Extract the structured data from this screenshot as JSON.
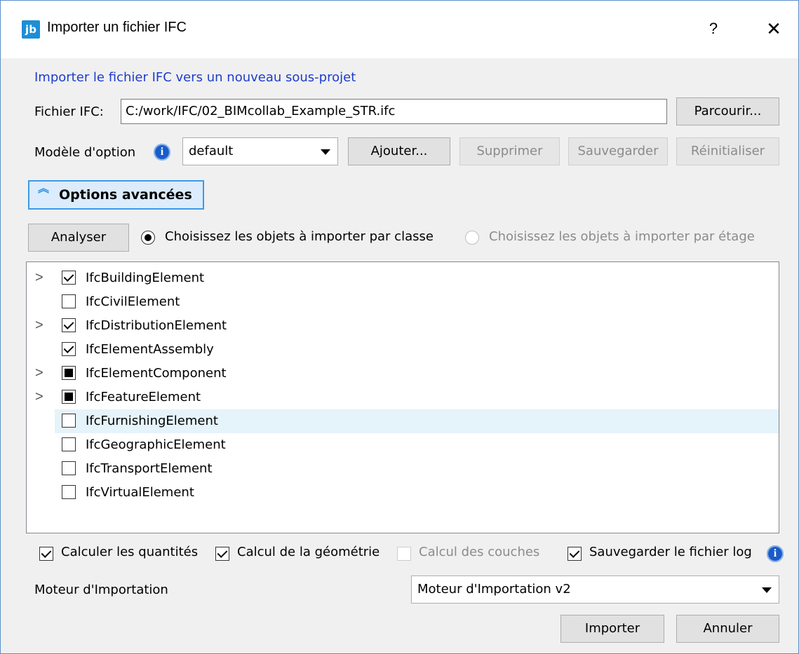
{
  "window": {
    "app_icon": "jb",
    "title": "Importer un fichier IFC",
    "help": "?",
    "close": "✕"
  },
  "heading": "Importer le fichier IFC vers un nouveau sous-projet",
  "file": {
    "label": "Fichier IFC:",
    "value": "C:/work/IFC/02_BIMcollab_Example_STR.ifc",
    "browse": "Parcourir..."
  },
  "option_model": {
    "label": "Modèle d'option",
    "selected": "default",
    "add": "Ajouter...",
    "delete": "Supprimer",
    "save": "Sauvegarder",
    "reset": "Réinitialiser"
  },
  "advanced": {
    "label": "Options avancées"
  },
  "analyse": {
    "button": "Analyser",
    "radio_class": "Choisissez les objets à importer par classe",
    "radio_floor": "Choisissez les objets à importer par étage",
    "selected": "class"
  },
  "tree": {
    "items": [
      {
        "label": "IfcBuildingElement",
        "state": "checked",
        "expandable": true
      },
      {
        "label": "IfcCivilElement",
        "state": "unchecked",
        "expandable": false
      },
      {
        "label": "IfcDistributionElement",
        "state": "checked",
        "expandable": true
      },
      {
        "label": "IfcElementAssembly",
        "state": "checked",
        "expandable": false
      },
      {
        "label": "IfcElementComponent",
        "state": "partial",
        "expandable": true
      },
      {
        "label": "IfcFeatureElement",
        "state": "partial",
        "expandable": true
      },
      {
        "label": "IfcFurnishingElement",
        "state": "unchecked",
        "expandable": false,
        "highlighted": true
      },
      {
        "label": "IfcGeographicElement",
        "state": "unchecked",
        "expandable": false
      },
      {
        "label": "IfcTransportElement",
        "state": "unchecked",
        "expandable": false
      },
      {
        "label": "IfcVirtualElement",
        "state": "unchecked",
        "expandable": false
      }
    ]
  },
  "options": {
    "quantities": {
      "label": "Calculer les quantités",
      "checked": true
    },
    "geometry": {
      "label": "Calcul de la géométrie",
      "checked": true
    },
    "layers": {
      "label": "Calcul des couches",
      "checked": false,
      "disabled": true
    },
    "log": {
      "label": "Sauvegarder le fichier log",
      "checked": true
    }
  },
  "engine": {
    "label": "Moteur d'Importation",
    "selected": "Moteur d'Importation v2"
  },
  "footer": {
    "import": "Importer",
    "cancel": "Annuler"
  },
  "colors": {
    "accent": "#1c8fd6",
    "heading": "#1e3ccc",
    "highlight": "#e5f3fb",
    "info": "#1a5cc8"
  }
}
